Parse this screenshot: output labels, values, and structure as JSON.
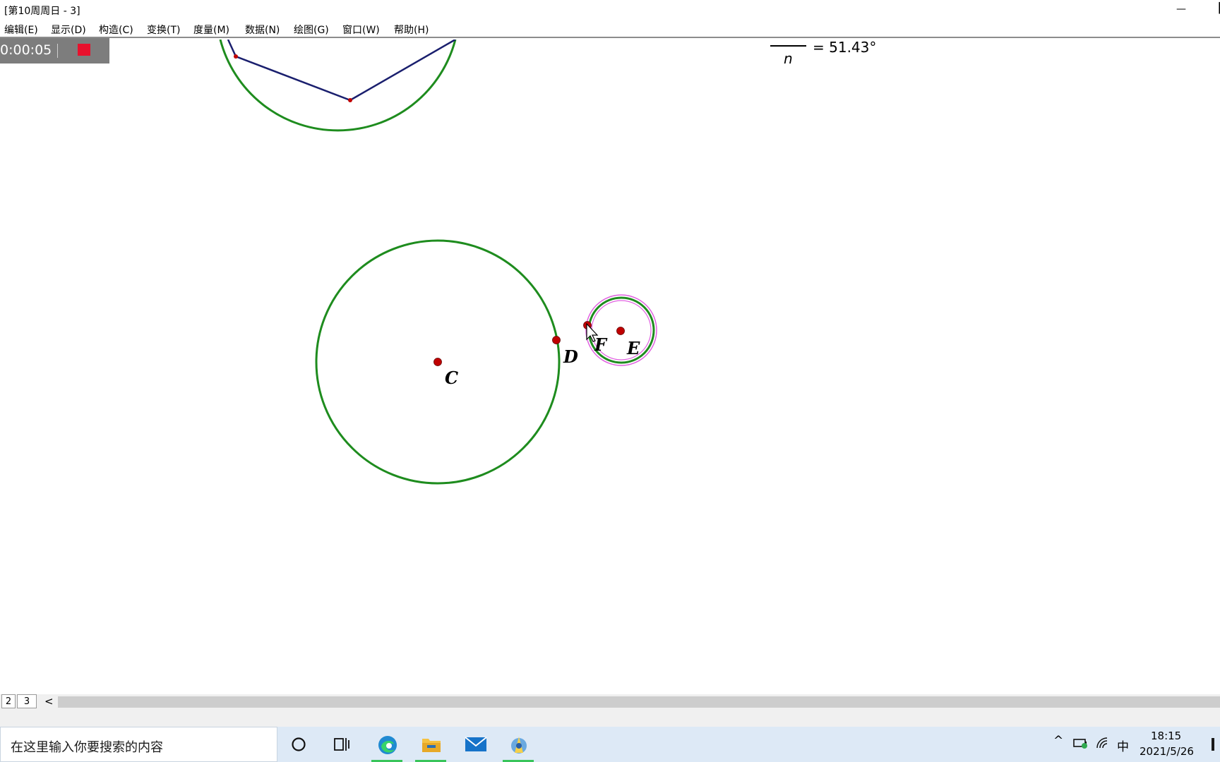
{
  "window": {
    "title": "[第10周周日 - 3]",
    "minimize_glyph": "—",
    "edge_glyph": "▐"
  },
  "menu": [
    {
      "label": "编辑(E)"
    },
    {
      "label": "显示(D)"
    },
    {
      "label": "构造(C)"
    },
    {
      "label": "变换(T)"
    },
    {
      "label": "度量(M)"
    },
    {
      "label": "数据(N)"
    },
    {
      "label": "绘图(G)"
    },
    {
      "label": "窗口(W)"
    },
    {
      "label": "帮助(H)"
    }
  ],
  "recorder": {
    "time": "0:00:05",
    "stop_color": "#e8112d"
  },
  "measurement": {
    "denominator": "n",
    "value": "= 51.43°"
  },
  "figure": {
    "circle_color": "#1e8c1e",
    "polygon_color": "#1a1f6e",
    "point_color": "#c00000",
    "selection_color": "#e060e0",
    "points": [
      {
        "label": "C"
      },
      {
        "label": "D"
      },
      {
        "label": "F"
      },
      {
        "label": "E"
      }
    ]
  },
  "pages": {
    "tabs": [
      {
        "label": "2"
      },
      {
        "label": "3"
      }
    ],
    "scroll_left_glyph": "<"
  },
  "taskbar": {
    "search_placeholder": "在这里输入你要搜索的内容",
    "ime_label": "中",
    "tray_arrow": "^",
    "time": "18:15",
    "date": "2021/5/26",
    "accent_color": "#38c45a"
  }
}
